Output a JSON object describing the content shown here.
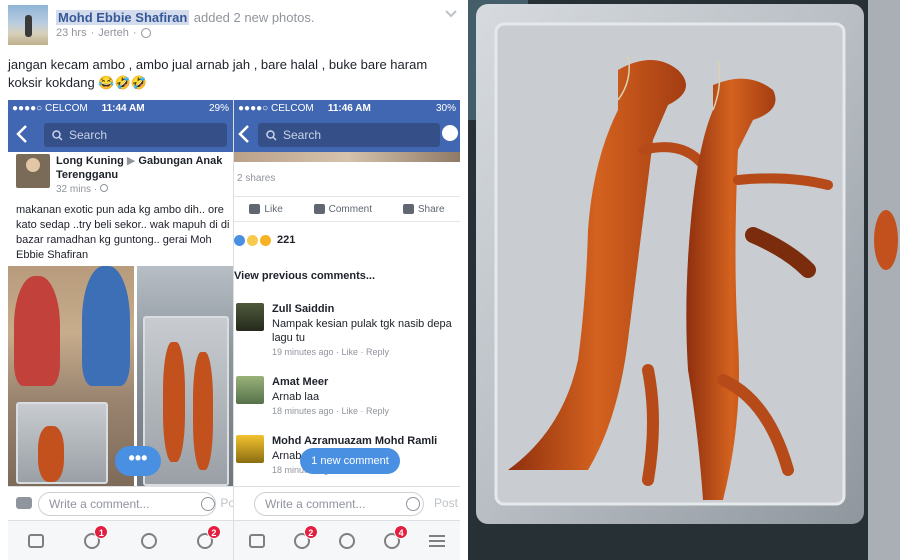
{
  "post": {
    "author": "Mohd Ebbie Shafiran",
    "action": "added 2 new photos.",
    "time": "23 hrs",
    "location": "Jerteh",
    "text": "jangan kecam ambo , ambo jual arnab jah , bare halal , buke bare haram koksir kokdang 😂🤣🤣"
  },
  "phone_a": {
    "carrier": "●●●●○ CELCOM",
    "time": "11:44 AM",
    "battery": "29%",
    "search_placeholder": "Search",
    "group_post": {
      "author": "Long Kuning",
      "group": "Gabungan Anak Terengganu",
      "time": "32 mins",
      "text": "makanan exotic pun ada kg ambo dih.. ore kato sedap ..try beli sekor.. wak mapuh di di bazar ramadhan kg guntong.. gerai Moh Ebbie Shafiran"
    },
    "more_label": "•••",
    "composer_placeholder": "Write a comment...",
    "post_label": "Po",
    "badges": {
      "friends": "1",
      "notifications": "2"
    }
  },
  "phone_b": {
    "carrier": "●●●●○ CELCOM",
    "time": "11:46 AM",
    "battery": "30%",
    "search_placeholder": "Search",
    "shares": "2 shares",
    "actions": {
      "like": "Like",
      "comment": "Comment",
      "share": "Share"
    },
    "reaction_count": "221",
    "view_previous": "View previous comments...",
    "comments": [
      {
        "name": "Zull Saiddin",
        "text": "Nampak kesian pulak tgk nasib depa lagu tu",
        "meta": "19 minutes ago · Like · Reply"
      },
      {
        "name": "Amat Meer",
        "text": "Arnab laa",
        "meta": "18 minutes ago · Like · Reply"
      },
      {
        "name": "Mohd Azramuazam Mohd Ramli",
        "text": "Arnab",
        "meta": "18 minutes ago"
      }
    ],
    "new_comment_label": "1 new comment",
    "composer_placeholder": "Write a comment...",
    "post_label": "Post",
    "badges": {
      "friends": "2",
      "notifications": "4"
    }
  },
  "colors": {
    "facebook_blue": "#4267b2",
    "link": "#365899",
    "badge_red": "#e41e3f",
    "roast_orange": "#c2511e"
  }
}
